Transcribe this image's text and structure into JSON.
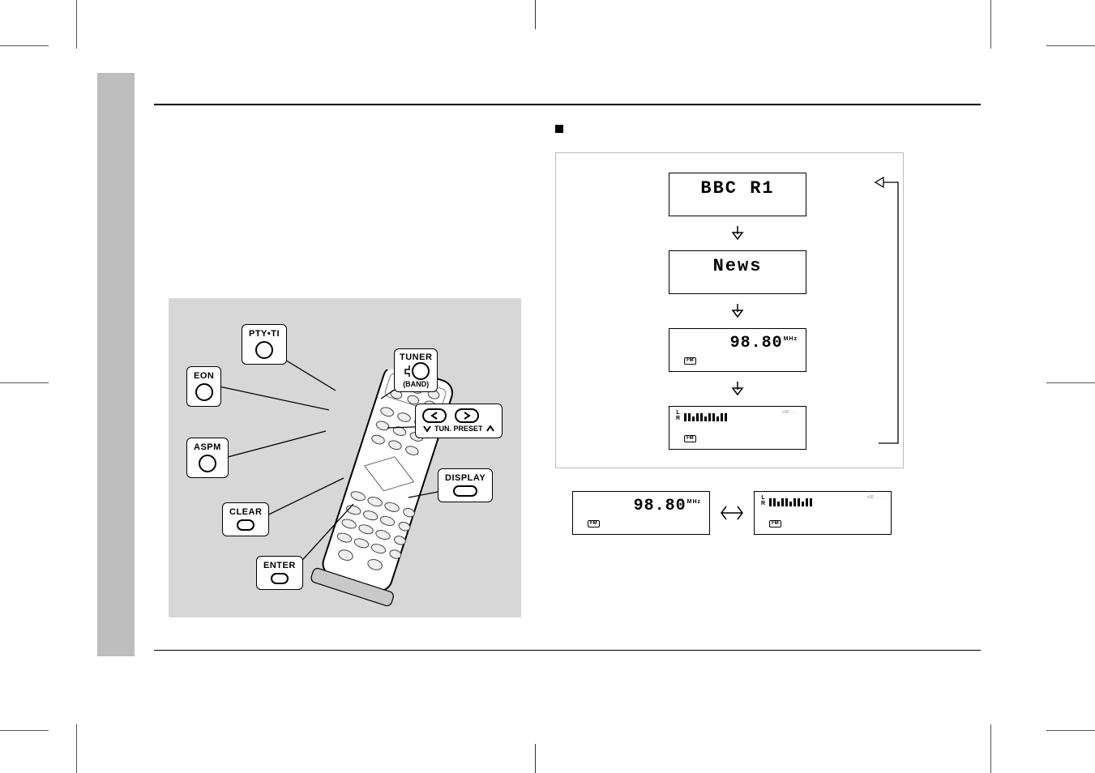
{
  "radio_displays": {
    "station_name": "BBC R1",
    "programme_type": "News",
    "frequency": "98.80",
    "freq_unit": "MHz",
    "band": "FM"
  },
  "bottom_pair": {
    "left_freq": "98.80",
    "freq_unit": "MHz",
    "band": "FM"
  },
  "remote": {
    "pty_ti": "PTY•TI",
    "eon": "EON",
    "aspm": "ASPM",
    "clear": "CLEAR",
    "enter": "ENTER",
    "tuner": "TUNER",
    "band": "(BAND)",
    "tun_preset": "TUN. PRESET",
    "display": "DISPLAY"
  },
  "tiny_labels": {
    "on": "",
    "other": ""
  }
}
